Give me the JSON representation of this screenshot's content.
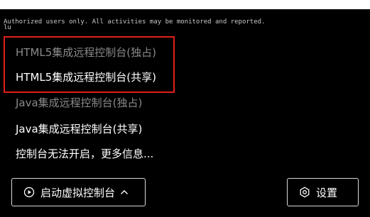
{
  "terminal": {
    "line1": "Authorized users only. All activities may be monitored and reported.",
    "line2": "lu"
  },
  "menu": {
    "items": [
      {
        "label": "HTML5集成远程控制台(独占)",
        "enabled": false
      },
      {
        "label": "HTML5集成远程控制台(共享)",
        "enabled": true
      },
      {
        "label": "Java集成远程控制台(独占)",
        "enabled": false
      },
      {
        "label": "Java集成远程控制台(共享)",
        "enabled": true
      },
      {
        "label": "控制台无法开启，更多信息...",
        "enabled": true
      }
    ]
  },
  "footer": {
    "launch_label": "启动虚拟控制台",
    "settings_label": "设置"
  },
  "colors": {
    "background": "#000000",
    "text_enabled": "#ffffff",
    "text_disabled": "#8a8a8a",
    "highlight": "#e0201a",
    "button_border": "#d9d9d9"
  },
  "icons": {
    "launch": "play-circle-icon",
    "caret": "chevron-up-icon",
    "settings": "hexagon-gear-icon"
  }
}
